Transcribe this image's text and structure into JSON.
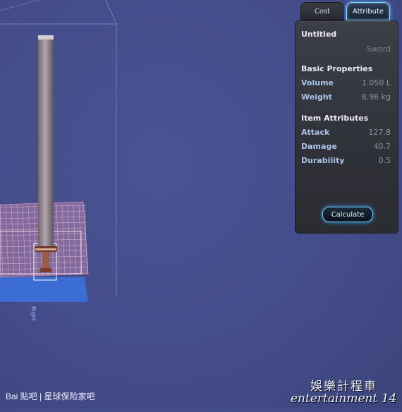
{
  "tabs": [
    {
      "label": "Cost"
    },
    {
      "label": "Attribute"
    }
  ],
  "item": {
    "name": "Untitled",
    "type": "Sword"
  },
  "basic_properties": {
    "heading": "Basic Properties",
    "rows": [
      {
        "label": "Volume",
        "value": "1.050 L"
      },
      {
        "label": "Weight",
        "value": "8.96 kg"
      }
    ]
  },
  "item_attributes": {
    "heading": "Item Attributes",
    "rows": [
      {
        "label": "Attack",
        "value": "127.8"
      },
      {
        "label": "Damage",
        "value": "40.7"
      },
      {
        "label": "Durability",
        "value": "0.5"
      }
    ]
  },
  "buttons": {
    "calculate": "Calculate"
  },
  "viewport": {
    "axis_label": "Right"
  },
  "watermarks": {
    "baidu": "Bai 贴吧 | 星球保险家吧",
    "entertainment_cn": "娛樂計程車",
    "entertainment_en": "entertainment 14"
  },
  "colors": {
    "background": "#444d8a",
    "accent_glow": "#49b8ff",
    "grid_pink": "#e9a9c6",
    "floor_blue": "#3d6fd6"
  }
}
